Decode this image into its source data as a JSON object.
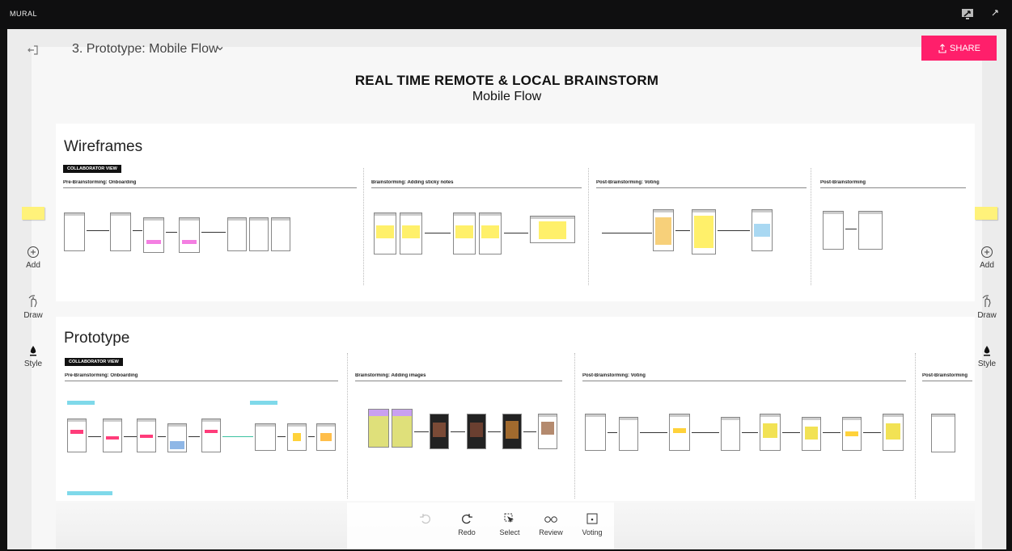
{
  "app": {
    "brand": "MURAL"
  },
  "header": {
    "mural_name": "3. Prototype: Mobile Flow",
    "share_label": "SHARE"
  },
  "board": {
    "title": "REAL TIME REMOTE & LOCAL BRAINSTORM",
    "subtitle": "Mobile Flow"
  },
  "wireframes": {
    "title": "Wireframes",
    "badge": "COLLABORATOR VIEW",
    "sections": [
      "Pre-Brainstorming: Onboarding",
      "Brainstorming: Adding sticky notes",
      "Post-Brainstorming: Voting",
      "Post-Brainstorming"
    ]
  },
  "prototype": {
    "title": "Prototype",
    "badge": "COLLABORATOR VIEW",
    "sections": [
      "Pre-Brainstorming: Onboarding",
      "Brainstorming: Adding images",
      "Post-Brainstorming: Voting",
      "Post-Brainstorming"
    ]
  },
  "left_tools": [
    {
      "label": "Add",
      "icon": "plus-circle-icon"
    },
    {
      "label": "Draw",
      "icon": "hand-draw-icon"
    },
    {
      "label": "Style",
      "icon": "ink-drop-icon"
    }
  ],
  "right_tools": [
    {
      "label": "Add",
      "icon": "plus-circle-icon"
    },
    {
      "label": "Draw",
      "icon": "hand-draw-icon"
    },
    {
      "label": "Style",
      "icon": "ink-drop-icon"
    }
  ],
  "bottom_tools": [
    {
      "label": "",
      "icon": "undo-icon",
      "enabled": false
    },
    {
      "label": "Redo",
      "icon": "redo-icon",
      "enabled": true
    },
    {
      "label": "Select",
      "icon": "select-icon",
      "enabled": true
    },
    {
      "label": "Review",
      "icon": "glasses-icon",
      "enabled": true
    },
    {
      "label": "Voting",
      "icon": "voting-icon",
      "enabled": true
    }
  ],
  "colors": {
    "share": "#ff1f6b",
    "sticky": "#fff27a",
    "topbar": "#0f0f10"
  }
}
